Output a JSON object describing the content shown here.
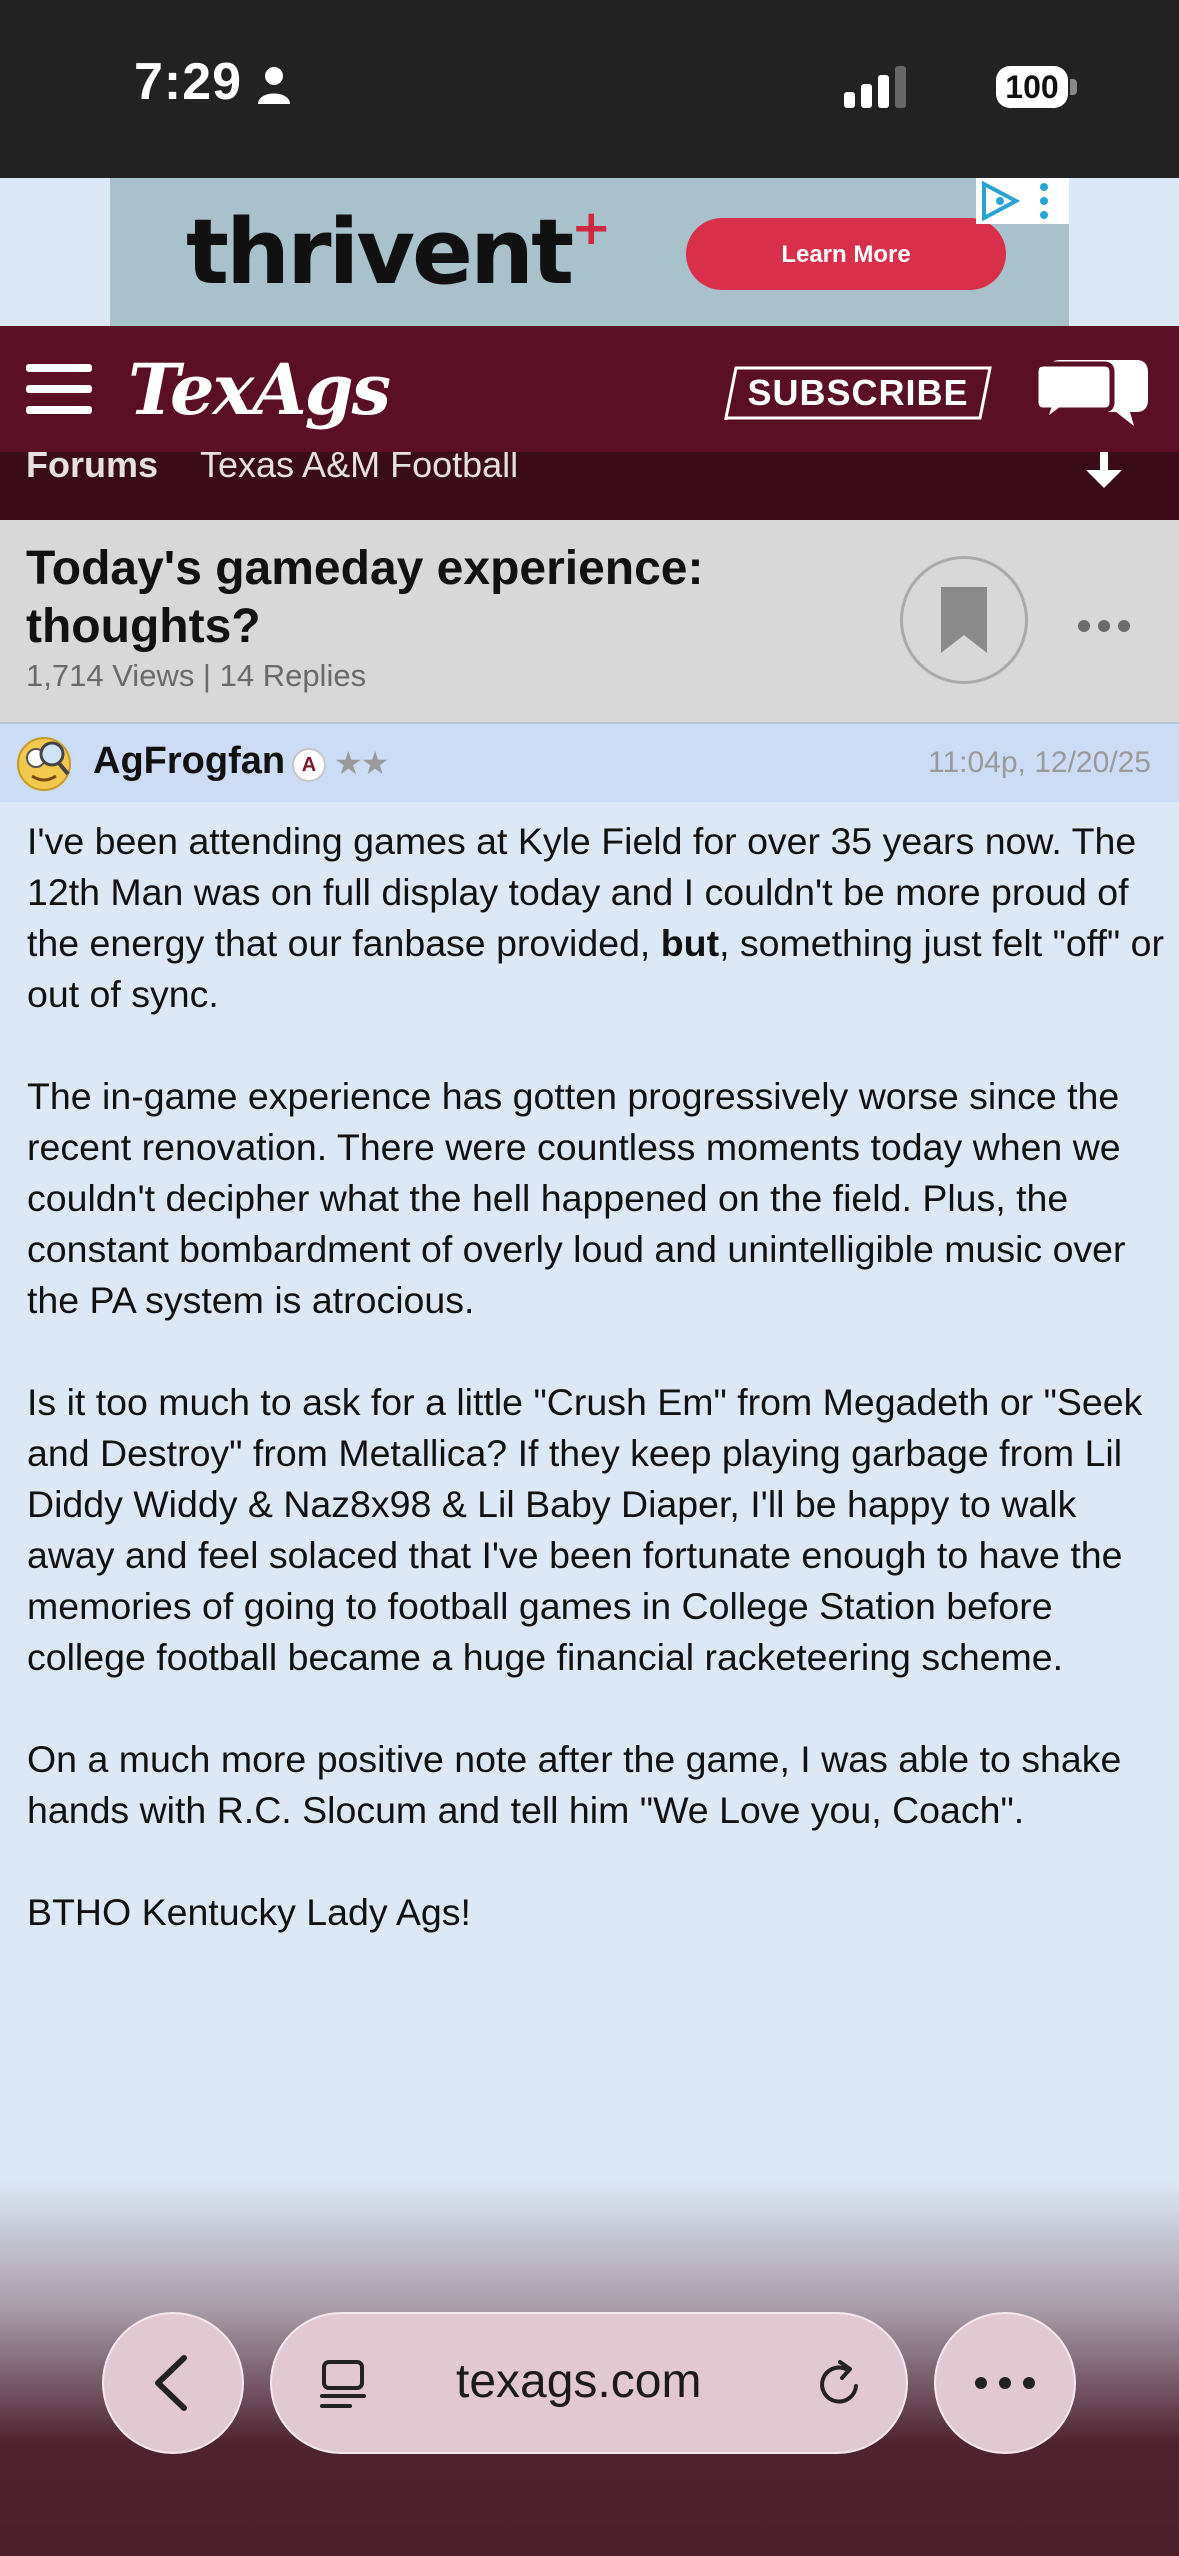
{
  "status": {
    "time": "7:29",
    "battery": "100"
  },
  "ad": {
    "brand": "thrivent",
    "button": "Learn More"
  },
  "header": {
    "logo": "TexAgs",
    "subscribe": "SUBSCRIBE"
  },
  "breadcrumb": {
    "forums": "Forums",
    "section": "Texas A&M Football"
  },
  "thread": {
    "title": "Today's gameday experience: thoughts?",
    "meta": "1,714 Views | 14 Replies"
  },
  "post": {
    "username": "AgFrogfan",
    "badge": "A",
    "stars": "★★",
    "timestamp": "11:04p, 12/20/25",
    "p1_before": "I've been attending games at Kyle Field for over 35 years now. The 12th Man was on full display today and I couldn't be more proud of the energy that our fanbase provided, ",
    "p1_bold": "but",
    "p1_after": ", something just felt \"off\" or out of sync.",
    "p2": "The in-game experience has gotten progressively worse since the recent renovation. There were countless moments today when we couldn't decipher what the hell happened on the field. Plus, the constant bombardment of overly loud and unintelligible music over the PA system is atrocious.",
    "p3": "Is it too much to ask for a little \"Crush Em\" from Megadeth or \"Seek and Destroy\" from Metallica? If they keep playing garbage from Lil Diddy Widdy & Naz8x98 & Lil Baby Diaper, I'll be happy to walk away and feel solaced that I've been fortunate enough to have the memories of going to football games in College Station before college football became a huge financial racketeering scheme.",
    "p4": "On a much more positive note after the game, I was able to shake hands with R.C. Slocum and tell him \"We Love you, Coach\".",
    "p5": "BTHO Kentucky Lady Ags!"
  },
  "browser": {
    "url": "texags.com"
  },
  "colors": {
    "maroon": "#5a0f24",
    "post_bg": "#dde8f6",
    "ad_button": "#d8304b"
  }
}
